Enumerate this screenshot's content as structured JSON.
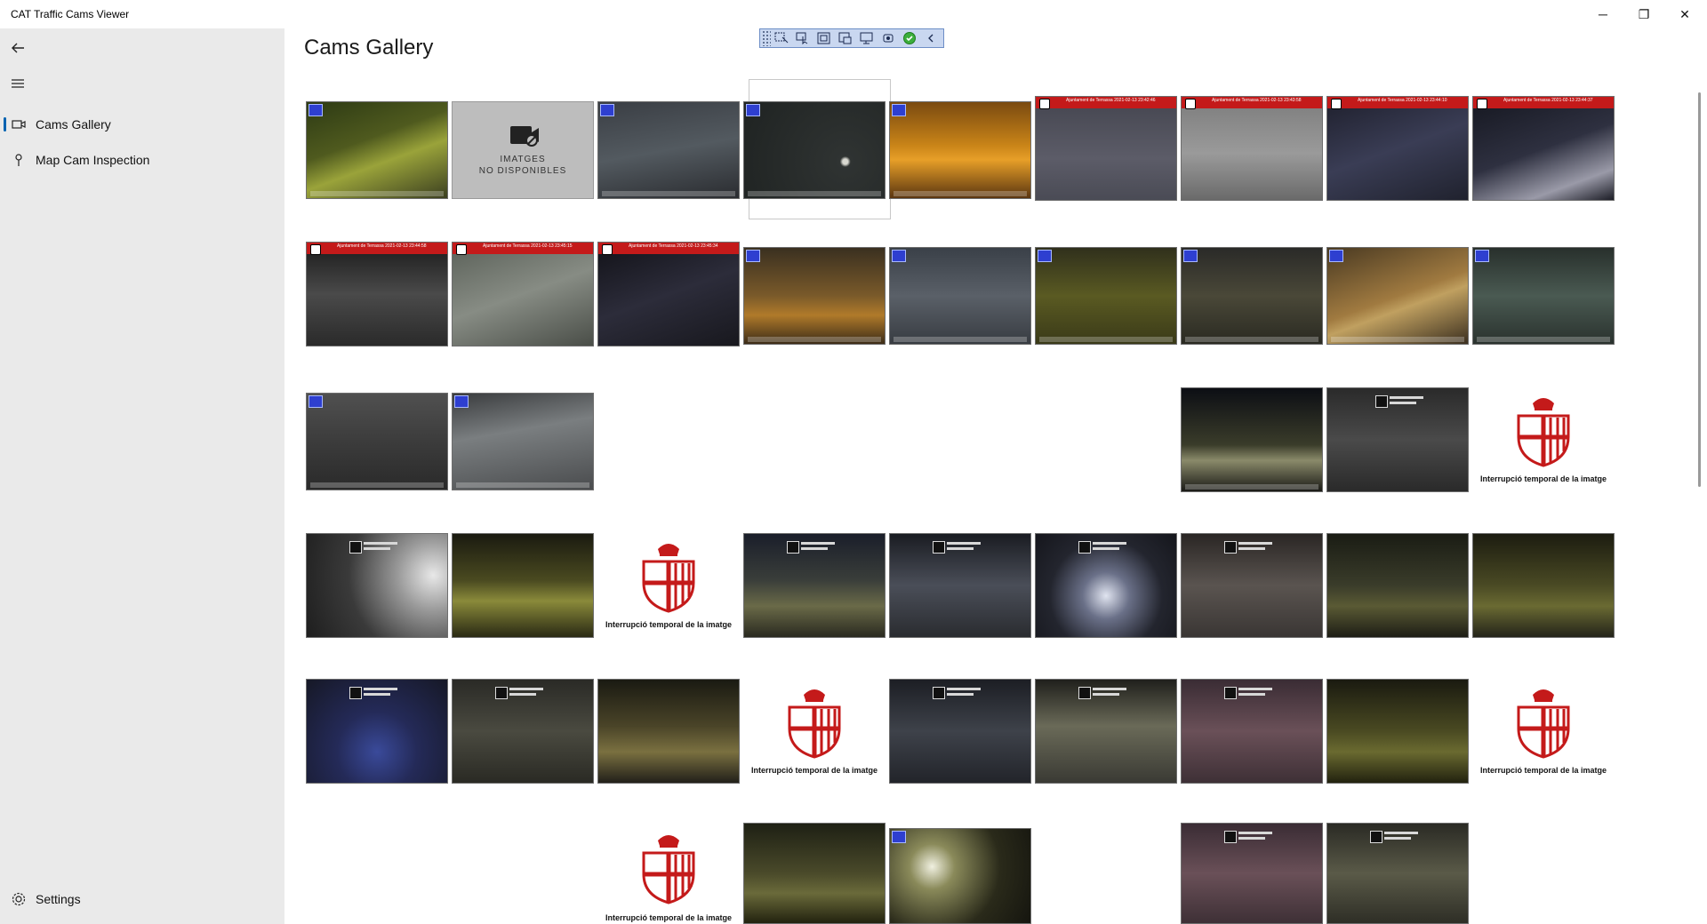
{
  "window": {
    "title": "CAT Traffic Cams Viewer",
    "minimize_glyph": "─",
    "maximize_glyph": "❐",
    "close_glyph": "✕"
  },
  "nav": {
    "back_icon": "back-arrow-icon",
    "menu_icon": "hamburger-icon",
    "items": [
      {
        "label": "Cams Gallery",
        "icon": "camera-icon",
        "selected": true
      },
      {
        "label": "Map Cam Inspection",
        "icon": "map-pin-icon",
        "selected": false
      }
    ],
    "settings_label": "Settings"
  },
  "page": {
    "title": "Cams Gallery"
  },
  "toolbar": {
    "buttons": [
      "select-region-icon",
      "pointer-icon",
      "frame-icon",
      "picture-icon",
      "screen-icon",
      "record-icon",
      "check-icon",
      "collapse-icon"
    ]
  },
  "gallery": {
    "unavailable_text_line1": "IMATGES",
    "unavailable_text_line2": "NO DISPONIBLES",
    "bcn_interruption_text": "Interrupció temporal de la imatge",
    "terrassa_overlay_1": "Ajuntament de Terrassa   2021-02-13  23:42:46",
    "terrassa_overlay_2": "Ajuntament de Terrassa   2021-02-13  23:43:58",
    "terrassa_overlay_3": "Ajuntament de Terrassa   2021-02-13  23:44:10",
    "terrassa_overlay_4": "Ajuntament de Terrassa   2021-02-13  23:44:37",
    "terrassa_overlay_5": "Ajuntament de Terrassa   2021-02-13  23:44:58",
    "terrassa_overlay_6": "Ajuntament de Terrassa   2021-02-13  23:45:15",
    "terrassa_overlay_7": "Ajuntament de Terrassa   2021-02-13  23:45:34"
  },
  "colors": {
    "accent": "#0063b1",
    "sidebar_bg": "#eaeaea",
    "bcn_red": "#c41a1a"
  }
}
